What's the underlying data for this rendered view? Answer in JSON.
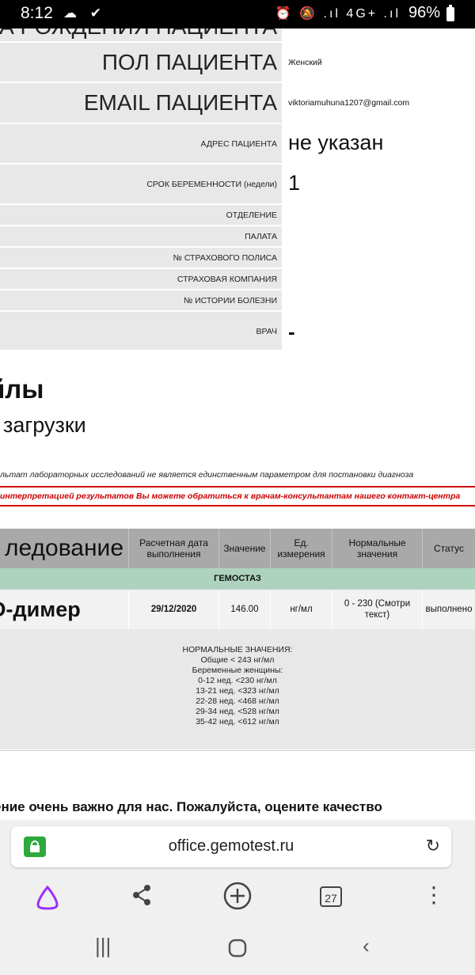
{
  "statusbar": {
    "time": "8:12",
    "left_icons": "☁ ✔",
    "right_icons": "⏰ 🔕 .ıl 4G+ .ıl",
    "battery": "96%"
  },
  "patient": {
    "top_cut_label": "А РОЖДЕНИЯ ПАЦИЕНТА",
    "sex_label": "ПОЛ ПАЦИЕНТА",
    "sex_value": "Женский",
    "email_label": "EMAIL ПАЦИЕНТА",
    "email_value": "viktoriamuhuna1207@gmail.com",
    "address_label": "АДРЕС ПАЦИЕНТА",
    "address_value": "не указан",
    "pregnancy_label": "СРОК БЕРЕМЕННОСТИ (недели)",
    "pregnancy_value": "1",
    "department_label": "ОТДЕЛЕНИЕ",
    "ward_label": "ПАЛАТА",
    "policy_label": "№ СТРАХОВОГО ПОЛИСА",
    "insurer_label": "СТРАХОВАЯ КОМПАНИЯ",
    "history_label": "№ ИСТОРИИ БОЛЕЗНИ",
    "doctor_label": "ВРАЧ",
    "doctor_value": "-"
  },
  "files": {
    "title": "йлы",
    "subtitle": "загрузки"
  },
  "notes": {
    "disclaimer": "льтат лабораторных исследований не является единственным параметром для постановки диагноза",
    "warning": "интерпретацией результатов Вы можете обратиться к врачам-консультантам нашего контакт-центра"
  },
  "results": {
    "headers": [
      "ледование",
      "Расчетная дата выполнения",
      "Значение",
      "Ед. измерения",
      "Нормальные значения",
      "Статус"
    ],
    "group": "ГЕМОСТАЗ",
    "row": {
      "test": "D-димер",
      "date": "29/12/2020",
      "value": "146.00",
      "unit": "нг/мл",
      "normal": "0 - 230 (Смотри текст)",
      "status": "выполнено"
    },
    "norm_lines": [
      "НОРМАЛЬНЫЕ ЗНАЧЕНИЯ:",
      "Общие < 243 нг/мл",
      "Беременные женщины:",
      "0-12 нед. <230 нг/мл",
      "13-21 нед. <323 нг/мл",
      "22-28 нед. <468 нг/мл",
      "29-34 нед. <528 нг/мл",
      "35-42 нед. <612 нг/мл"
    ]
  },
  "feedback": "ение очень важно для нас. Пожалуйста, оцените качество",
  "browser": {
    "url": "office.gemotest.ru",
    "tab_count": "27",
    "accent": "#9b30ff"
  }
}
